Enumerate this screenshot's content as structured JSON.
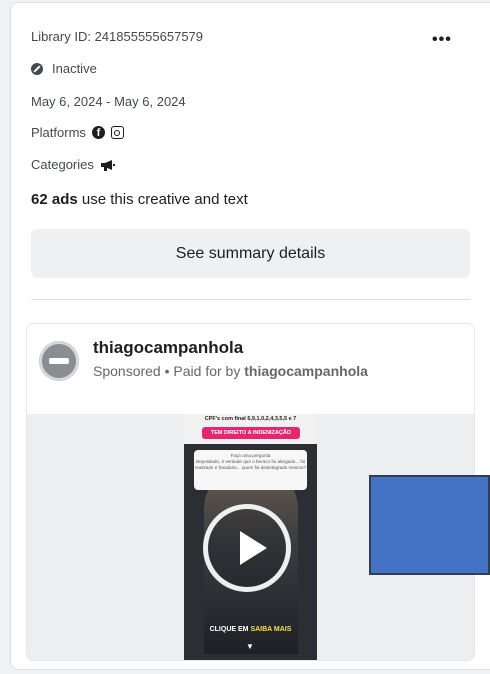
{
  "card": {
    "library_id": "Library ID: 241855555657579",
    "more_label": "•••",
    "status": "Inactive",
    "date_range": "May 6, 2024 - May 6, 2024",
    "platforms_label": "Platforms",
    "platform_icons": [
      "facebook-icon",
      "instagram-icon"
    ],
    "categories_label": "Categories",
    "category_icon": "megaphone-icon",
    "ads_count": "62 ads",
    "ads_text": " use this creative and text",
    "summary_button": "See summary details"
  },
  "ad": {
    "page_name": "thiagocampanhola",
    "sponsored": "Sponsored",
    "separator": " • ",
    "paid_for_prefix": "Paid for by ",
    "paid_for_name": "thiagocampanhola",
    "video": {
      "top_text": "CPF's com final 6,9,1,0,2,4,3,5,5 e 7",
      "banner": "TEM DIREITO A INDENIZAÇÃO",
      "message": "Depositado, é verdade que o beraco foi alargado... foi realizado e fraudaria... quem foi desintegrado mesmo?",
      "message_header": "Faça uma pergunta",
      "cta_prefix": "CLIQUE EM ",
      "cta_highlight": "SAIBA MAIS"
    }
  },
  "colors": {
    "overlay": "#4472c4",
    "banner": "#e6276e"
  }
}
